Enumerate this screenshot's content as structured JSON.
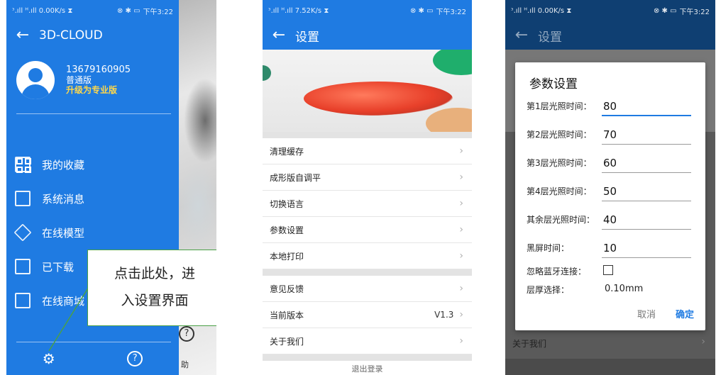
{
  "phone1": {
    "status": {
      "signal": "ᵌ.ıll ᴴ.ıll",
      "speed": "0.00K/s",
      "icons": "⊗ ✱ ▭",
      "time": "下午3:22"
    },
    "header": {
      "back": "←",
      "title": "3D-CLOUD"
    },
    "profile": {
      "phone": "13679160905",
      "edition": "普通版",
      "upgrade": "升级为专业版"
    },
    "menu": [
      "我的收藏",
      "系统消息",
      "在线模型",
      "已下载",
      "在线商城"
    ],
    "callout": {
      "line1": "点击此处，进",
      "line2": "入设置界面"
    },
    "bottom": {
      "settings_icon": "gear-icon",
      "help": "?"
    },
    "peek": {
      "help": "?",
      "text": "助"
    },
    "colors": {
      "drawer": "#1f7be2",
      "upgrade": "#ffd84a",
      "callout_border": "#4aa046"
    }
  },
  "phone2": {
    "status": {
      "signal": "ᵌ.ıll ᴴ.ıll",
      "speed": "7.52K/s",
      "icons": "⊗ ✱ ▭",
      "time": "下午3:22"
    },
    "header": {
      "back": "←",
      "title": "设置"
    },
    "group1": [
      "清理缓存",
      "成形版自调平",
      "切换语言",
      "参数设置",
      "本地打印"
    ],
    "group2": [
      {
        "label": "意见反馈",
        "value": ""
      },
      {
        "label": "当前版本",
        "value": "V1.3"
      },
      {
        "label": "关于我们",
        "value": ""
      }
    ],
    "chevron": "›",
    "logout_peek": "退出登录"
  },
  "phone3": {
    "status": {
      "signal": "ᵌ.ıll ᴴ.ıll",
      "speed": "0.00K/s",
      "icons": "⊗ ✱ ▭",
      "time": "下午3:22"
    },
    "header": {
      "back": "←",
      "title": "设置"
    },
    "under_label": "关于我们",
    "dialog": {
      "title": "参数设置",
      "fields": [
        {
          "label": "第1层光照时间：",
          "value": "80"
        },
        {
          "label": "第2层光照时间：",
          "value": "70"
        },
        {
          "label": "第3层光照时间：",
          "value": "60"
        },
        {
          "label": "第4层光照时间：",
          "value": "50"
        },
        {
          "label": "其余层光照时间：",
          "value": "40"
        },
        {
          "label": "黑屏时间：",
          "value": "10"
        }
      ],
      "ignore_bt_label": "忽略蓝牙连接：",
      "ignore_bt_checked": false,
      "layer_label": "层厚选择：",
      "layer_value": "0.10mm",
      "cancel": "取消",
      "ok": "确定"
    }
  }
}
